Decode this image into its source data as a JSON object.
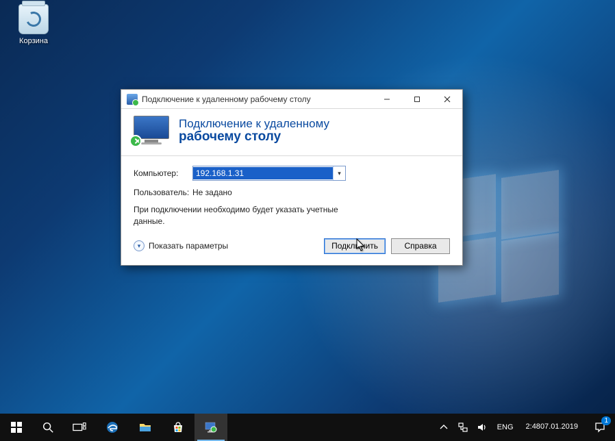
{
  "desktop": {
    "recycle_bin_label": "Корзина"
  },
  "rdp": {
    "window_title": "Подключение к удаленному рабочему столу",
    "banner_line1": "Подключение к удаленному",
    "banner_line2": "рабочему столу",
    "computer_label": "Компьютер:",
    "computer_value": "192.168.1.31",
    "user_label": "Пользователь:",
    "user_value": "Не задано",
    "hint": "При подключении необходимо будет указать учетные данные.",
    "show_options": "Показать параметры",
    "connect": "Подключить",
    "help": "Справка"
  },
  "taskbar": {
    "lang": "ENG",
    "time": "2:48",
    "date": "07.01.2019",
    "notification_count": "1"
  }
}
